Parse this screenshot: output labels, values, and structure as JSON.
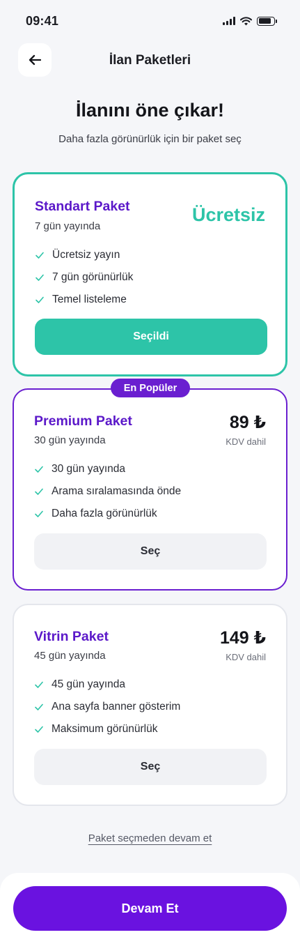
{
  "status_bar": {
    "time": "09:41",
    "battery_level": 0.85
  },
  "header": {
    "title": "İlan Paketleri",
    "back_icon": "arrow-left-icon"
  },
  "hero": {
    "title": "İlanını öne çıkar!",
    "subtitle": "Daha fazla görünürlük için bir paket seç"
  },
  "colors": {
    "accent_green": "#2dc4a8",
    "accent_purple": "#6a1fd0",
    "cta": "#6a12e0"
  },
  "packages": [
    {
      "name": "Standart Paket",
      "duration": "7 gün yayında",
      "price": "Ücretsiz",
      "features": [
        "Ücretsiz yayın",
        "7 gün görünürlük",
        "Temel listeleme"
      ],
      "button": "Seçildi",
      "selected": true
    },
    {
      "badge": "En Popüler",
      "name": "Premium Paket",
      "duration": "30 gün yayında",
      "price": "89 ₺",
      "tax_note": "KDV dahil",
      "features": [
        "30 gün yayında",
        "Arama sıralamasında önde",
        "Daha fazla görünürlük"
      ],
      "button": "Seç",
      "selected": false
    },
    {
      "name": "Vitrin Paket",
      "duration": "45 gün yayında",
      "price": "149 ₺",
      "tax_note": "KDV dahil",
      "features": [
        "45 gün yayında",
        "Ana sayfa banner gösterim",
        "Maksimum görünürlük"
      ],
      "button": "Seç",
      "selected": false
    }
  ],
  "skip_link": "Paket seçmeden devam et",
  "continue_button": "Devam Et"
}
